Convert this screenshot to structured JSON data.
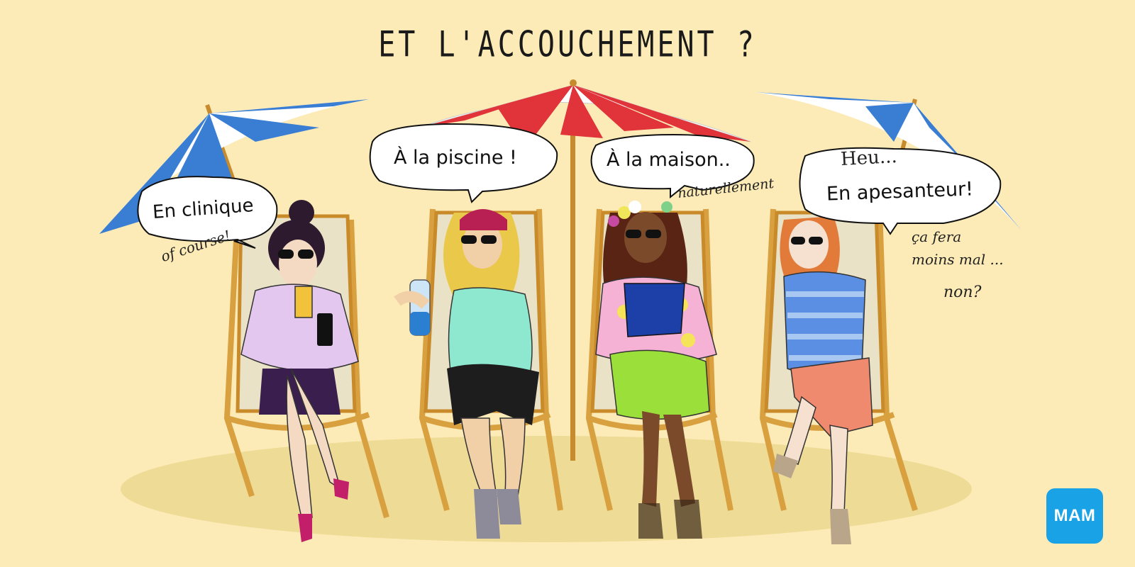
{
  "title": "ET L'ACCOUCHEMENT ?",
  "bubbles": [
    {
      "main": "En clinique",
      "note": "of course!"
    },
    {
      "main": "À la piscine !"
    },
    {
      "main": "À la maison..",
      "note": "naturellement"
    },
    {
      "top": "Heu...",
      "main": "En apesanteur!",
      "note1": "ça fera",
      "note2": "moins mal ...",
      "note3": "non?"
    }
  ],
  "logo": "MAM",
  "colors": {
    "background": "#fcebb6",
    "umbrella_blue": "#3a7ed4",
    "umbrella_red": "#e0333a",
    "logo_blue": "#1aa2e6"
  }
}
